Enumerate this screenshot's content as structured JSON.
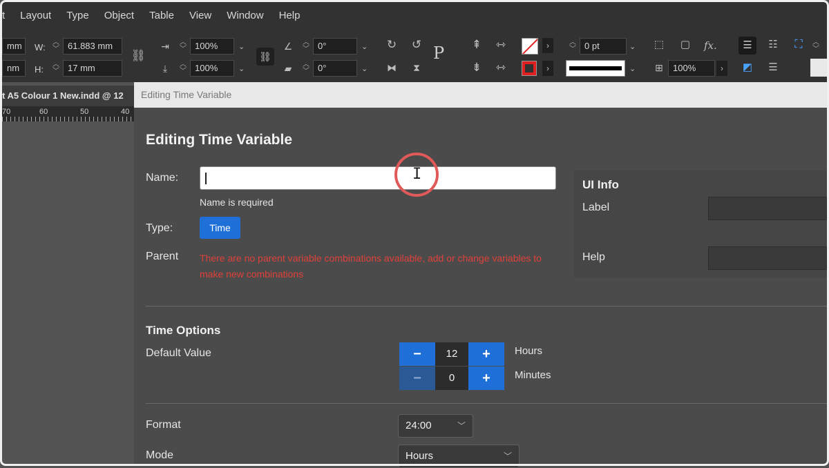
{
  "menubar": {
    "items": [
      "t",
      "Layout",
      "Type",
      "Object",
      "Table",
      "View",
      "Window",
      "Help"
    ]
  },
  "control_panel": {
    "x_value": "mm",
    "y_value": "nm",
    "w_label": "W:",
    "w_value": "61.883 mm",
    "h_label": "H:",
    "h_value": "17 mm",
    "scale_x": "100%",
    "scale_y": "100%",
    "rotate": "0°",
    "shear": "0°",
    "stroke_weight": "0 pt",
    "opacity": "100%",
    "p_glyph": "P",
    "fx_glyph": "fx."
  },
  "document": {
    "tab_title": "t A5 Colour 1 New.indd @ 12",
    "ruler_labels": [
      "70",
      "60",
      "50",
      "40"
    ]
  },
  "dialog": {
    "window_title": "Editing Time Variable",
    "heading": "Editing Time Variable",
    "name_label": "Name:",
    "name_value": "",
    "name_hint": "Name is required",
    "type_label": "Type:",
    "type_button": "Time",
    "parent_label": "Parent",
    "parent_error": "There are no parent variable combinations available, add or change variables to make new combinations",
    "ui_info": {
      "title": "UI Info",
      "label_label": "Label",
      "label_value": "",
      "help_label": "Help",
      "help_value": ""
    },
    "time_options": {
      "title": "Time Options",
      "default_value_label": "Default Value",
      "hours_value": "12",
      "hours_unit": "Hours",
      "minutes_value": "0",
      "minutes_unit": "Minutes",
      "minus": "−",
      "plus": "+"
    },
    "format_label": "Format",
    "format_value": "24:00",
    "mode_label": "Mode",
    "mode_value": "Hours"
  },
  "colors": {
    "accent_blue": "#1f6fd8",
    "error_red": "#e0403a",
    "highlight_ring": "#e05a5a"
  }
}
